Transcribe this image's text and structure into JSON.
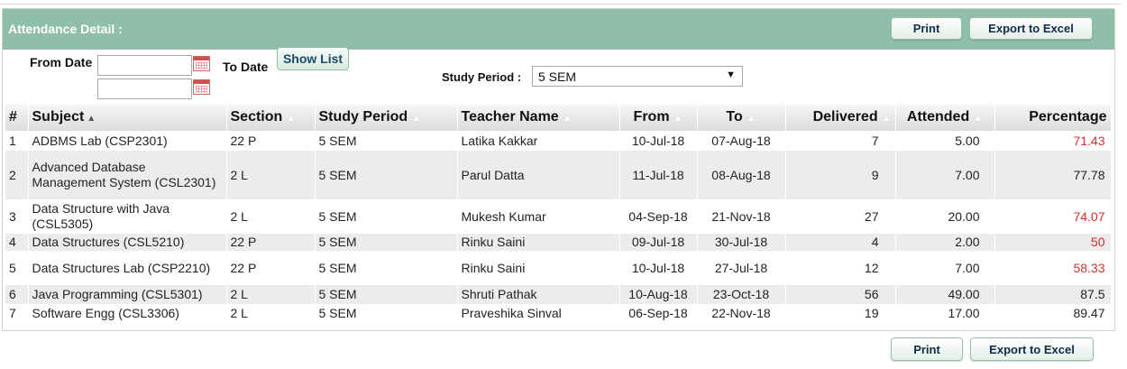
{
  "header": {
    "title": "Attendance Detail :",
    "print_label": "Print",
    "export_label": "Export to Excel"
  },
  "filters": {
    "from_date_label": "From Date",
    "to_date_label": "To Date",
    "from_date_value": "",
    "to_date_value": "",
    "show_list_label": "Show List",
    "study_period_label": "Study Period :",
    "study_period_selected": "5 SEM"
  },
  "table": {
    "columns": [
      "#",
      "Subject",
      "Section",
      "Study Period",
      "Teacher Name",
      "From",
      "To",
      "Delivered",
      "Attended",
      "Percentage"
    ],
    "rows": [
      {
        "no": "1",
        "subject": "ADBMS Lab (CSP2301)",
        "section": "22 P",
        "period": "5 SEM",
        "teacher": "Latika Kakkar",
        "from": "10-Jul-18",
        "to": "07-Aug-18",
        "delivered": "7",
        "attended": "5.00",
        "percentage": "71.43",
        "low": true
      },
      {
        "no": "2",
        "subject": "Advanced Database Management System (CSL2301)",
        "section": "2 L",
        "period": "5 SEM",
        "teacher": "Parul Datta",
        "from": "11-Jul-18",
        "to": "08-Aug-18",
        "delivered": "9",
        "attended": "7.00",
        "percentage": "77.78",
        "low": false
      },
      {
        "no": "3",
        "subject": "Data Structure with Java (CSL5305)",
        "section": "2 L",
        "period": "5 SEM",
        "teacher": "Mukesh Kumar",
        "from": "04-Sep-18",
        "to": "21-Nov-18",
        "delivered": "27",
        "attended": "20.00",
        "percentage": "74.07",
        "low": true
      },
      {
        "no": "4",
        "subject": "Data Structures (CSL5210)",
        "section": "22 P",
        "period": "5 SEM",
        "teacher": "Rinku Saini",
        "from": "09-Jul-18",
        "to": "30-Jul-18",
        "delivered": "4",
        "attended": "2.00",
        "percentage": "50",
        "low": true
      },
      {
        "no": "5",
        "subject": "Data Structures Lab (CSP2210)",
        "section": "22 P",
        "period": "5 SEM",
        "teacher": "Rinku Saini",
        "from": "10-Jul-18",
        "to": "27-Jul-18",
        "delivered": "12",
        "attended": "7.00",
        "percentage": "58.33",
        "low": true
      },
      {
        "no": "6",
        "subject": "Java Programming (CSL5301)",
        "section": "2 L",
        "period": "5 SEM",
        "teacher": "Shruti Pathak",
        "from": "10-Aug-18",
        "to": "23-Oct-18",
        "delivered": "56",
        "attended": "49.00",
        "percentage": "87.5",
        "low": false
      },
      {
        "no": "7",
        "subject": "Software Engg (CSL3306)",
        "section": "2 L",
        "period": "5 SEM",
        "teacher": "Praveshika Sinval",
        "from": "06-Sep-18",
        "to": "22-Nov-18",
        "delivered": "19",
        "attended": "17.00",
        "percentage": "89.47",
        "low": false
      }
    ]
  },
  "footer": {
    "print_label": "Print",
    "export_label": "Export to Excel"
  },
  "colors": {
    "header_bg": "#8fbfa9",
    "low_percentage": "#d32f2f"
  }
}
